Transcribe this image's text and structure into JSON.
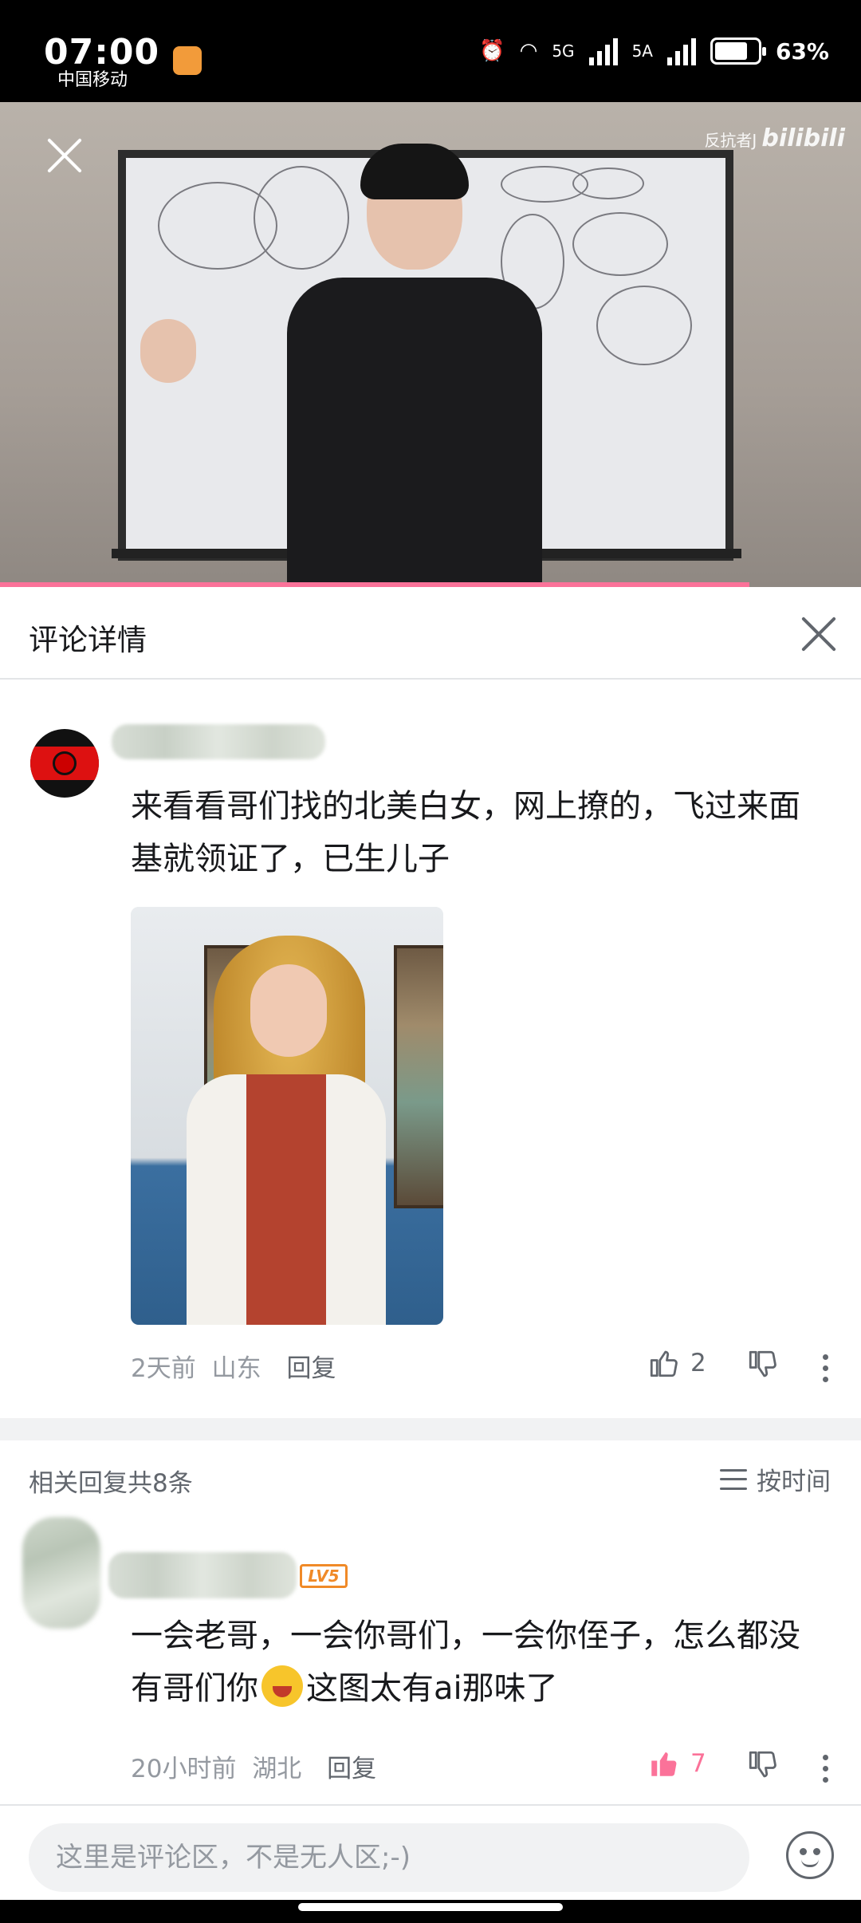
{
  "status_bar": {
    "time": "07:00",
    "carrier": "中国移动",
    "network": "5G",
    "network2": "5A",
    "battery": "63%"
  },
  "video": {
    "watermark_prefix": "反抗者J",
    "watermark_brand": "bilibili"
  },
  "panel": {
    "title": "评论详情"
  },
  "main_comment": {
    "text": "来看看哥们找的北美白女，网上撩的，飞过来面基就领证了，已生儿子",
    "time": "2天前",
    "location": "山东",
    "reply_label": "回复",
    "like_count": "2"
  },
  "replies": {
    "header": "相关回复共8条",
    "sort_label": "按时间",
    "items": [
      {
        "level": "LV5",
        "text_before_emoji": "一会老哥，一会你哥们，一会你侄子，怎么都没有哥们你",
        "text_after_emoji": "这图太有ai那味了",
        "time": "20小时前",
        "location": "湖北",
        "reply_label": "回复",
        "like_count": "7"
      }
    ]
  },
  "bottom_bar": {
    "input_placeholder": "这里是评论区，不是无人区;-)"
  },
  "colors": {
    "accent_pink": "#fb7299",
    "text_primary": "#18191c",
    "text_secondary": "#9499a0",
    "level_orange": "#f08a28"
  }
}
